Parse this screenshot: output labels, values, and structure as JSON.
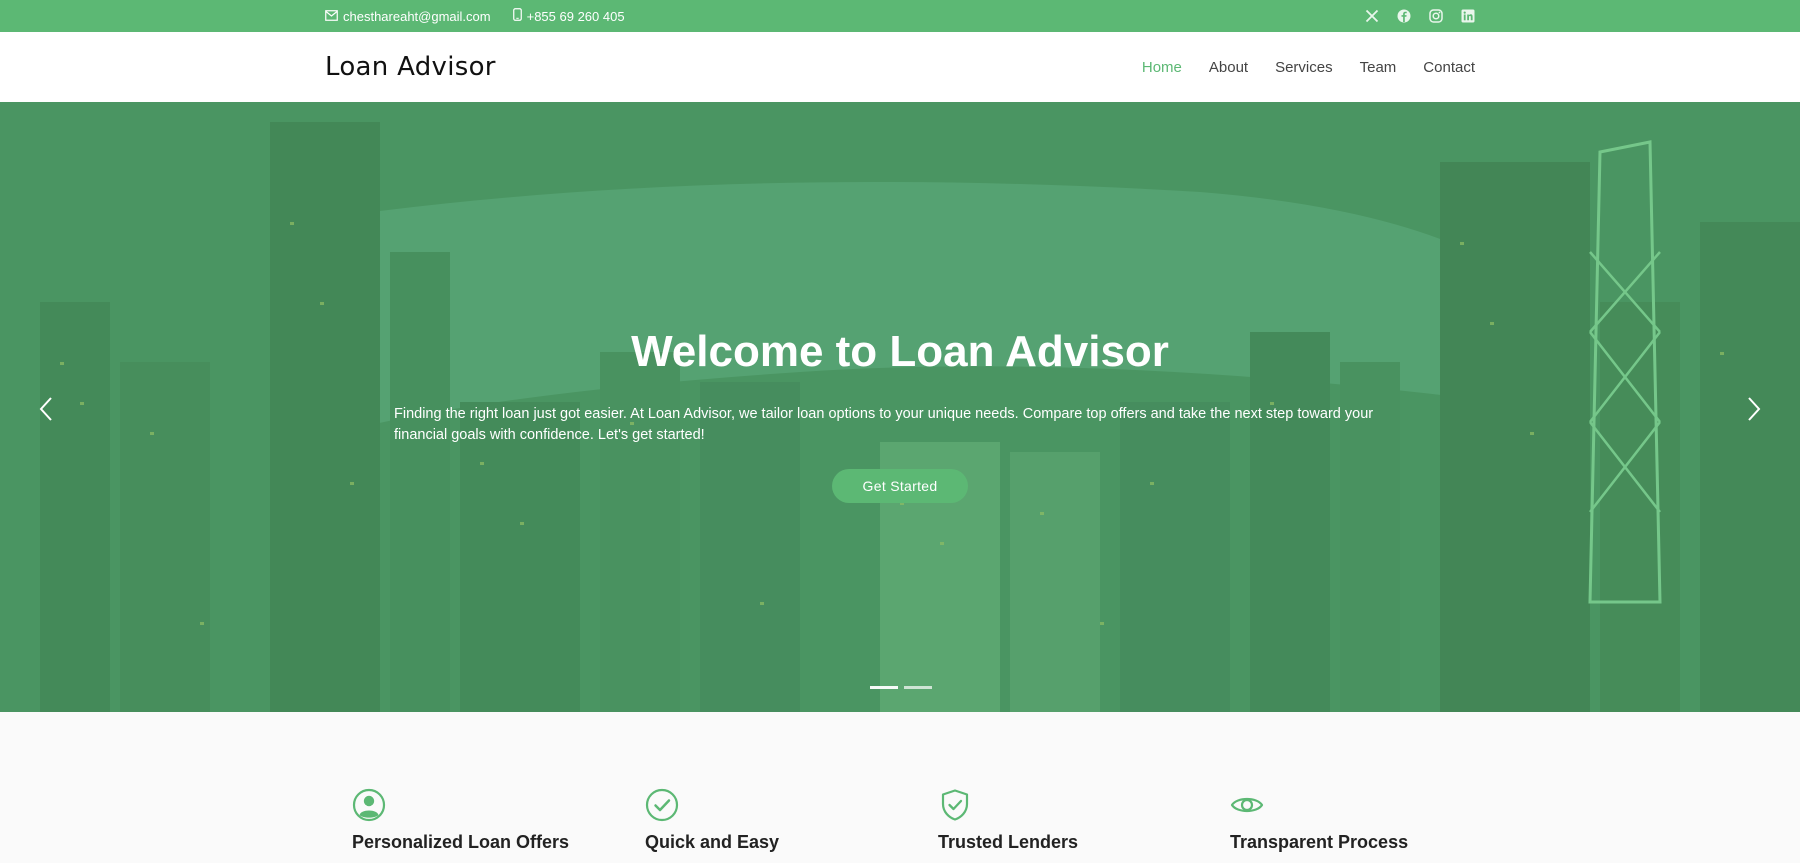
{
  "topbar": {
    "email": "chesthareaht@gmail.com",
    "phone": "+855 69 260 405",
    "social": [
      "x-icon",
      "facebook-icon",
      "instagram-icon",
      "linkedin-icon"
    ]
  },
  "header": {
    "logo": "Loan Advisor",
    "nav": [
      "Home",
      "About",
      "Services",
      "Team",
      "Contact"
    ],
    "active": "Home"
  },
  "hero": {
    "title": "Welcome to Loan Advisor",
    "text": "Finding the right loan just got easier. At Loan Advisor, we tailor loan options to your unique needs. Compare top offers and take the next step toward your financial goals with confidence. Let's get started!",
    "cta": "Get Started",
    "slides": 2,
    "active_slide": 1
  },
  "features": [
    {
      "icon": "user-circle-icon",
      "title": "Personalized Loan Offers"
    },
    {
      "icon": "check-circle-icon",
      "title": "Quick and Easy"
    },
    {
      "icon": "shield-check-icon",
      "title": "Trusted Lenders"
    },
    {
      "icon": "eye-icon",
      "title": "Transparent Process"
    }
  ],
  "colors": {
    "accent": "#5cb874",
    "text": "#222222"
  }
}
